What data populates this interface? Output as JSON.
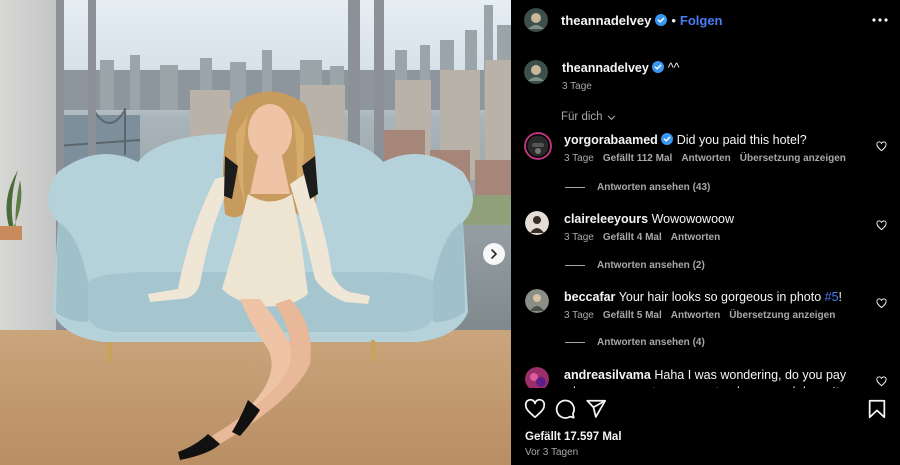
{
  "post": {
    "username": "theannadelvey",
    "follow_label": "Folgen",
    "caption_username": "theannadelvey",
    "caption_text": "^^",
    "caption_time": "3 Tage",
    "sort_label": "Für dich",
    "likes_label": "Gefällt 17.597 Mal",
    "date_label": "Vor 3 Tagen"
  },
  "comments": [
    {
      "username": "yorgorabaamed",
      "verified": true,
      "text": "Did you paid this hotel?",
      "time": "3 Tage",
      "likes": "Gefällt 112 Mal",
      "reply": "Antworten",
      "translate": "Übersetzung anzeigen",
      "view_replies": "Antworten ansehen (43)",
      "avatar_color": "#2a2a2a"
    },
    {
      "username": "claireleeyours",
      "verified": false,
      "text": "Wowowowoow",
      "time": "3 Tage",
      "likes": "Gefällt 4 Mal",
      "reply": "Antworten",
      "translate": "",
      "view_replies": "Antworten ansehen (2)",
      "avatar_color": "#d9d2c9"
    },
    {
      "username": "beccafar",
      "verified": false,
      "text_before": "Your hair looks so gorgeous in photo ",
      "text_link": "#5",
      "text_after": "!",
      "time": "3 Tage",
      "likes": "Gefällt 5 Mal",
      "reply": "Antworten",
      "translate": "Übersetzung anzeigen",
      "view_replies": "Antworten ansehen (4)",
      "avatar_color": "#8a8f86"
    },
    {
      "username": "andreasilvama",
      "verified": false,
      "text": "Haha I was wondering, do you pay when you go out or you pretend your card doesn't work and someone",
      "avatar_color": "#9b2f6a"
    }
  ],
  "icons": {
    "more": "more-horizontal-icon",
    "verified": "verified-badge-icon",
    "chevron": "chevron-down-icon",
    "heart": "heart-icon",
    "comment": "comment-icon",
    "share": "share-icon",
    "save": "bookmark-icon",
    "next": "chevron-right-icon"
  },
  "colors": {
    "background": "#000000",
    "text": "#f5f5f5",
    "muted": "#a8a8a8",
    "accent": "#4a7cf6",
    "sofa": "#b7d3dc",
    "dress": "#ede4d2"
  }
}
